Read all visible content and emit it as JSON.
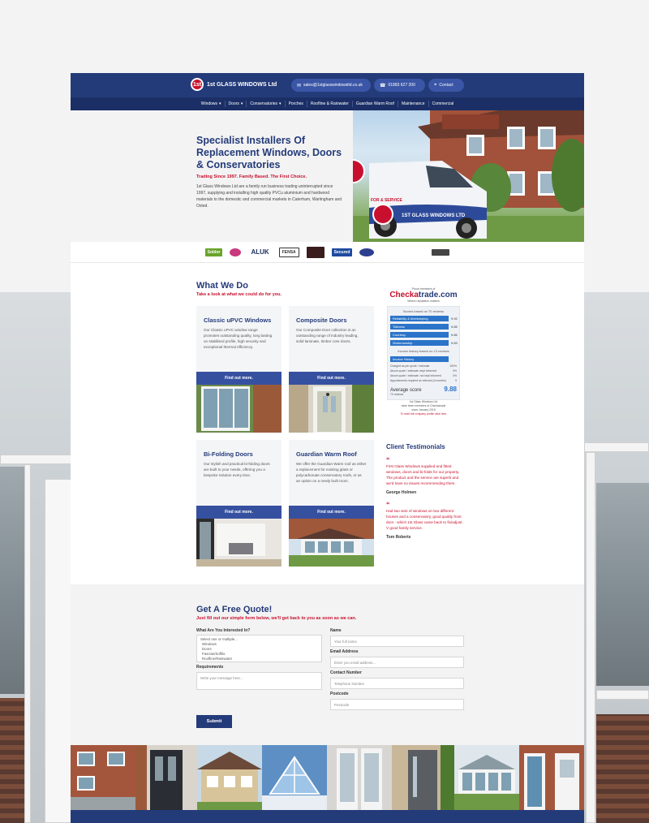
{
  "header": {
    "logo_text": "1st GLASS WINDOWS Ltd",
    "logo_badge": "1st",
    "email": "sales@1stglasswindowsltd.co.uk",
    "phone": "01883 627 200",
    "contact_label": "Contact"
  },
  "nav": {
    "items": [
      {
        "label": "Windows",
        "dropdown": true
      },
      {
        "label": "Doors",
        "dropdown": true
      },
      {
        "label": "Conservatories",
        "dropdown": true
      },
      {
        "label": "Porches",
        "dropdown": false
      },
      {
        "label": "Roofline & Rainwater",
        "dropdown": false
      },
      {
        "label": "Guardian Warm Roof",
        "dropdown": false
      },
      {
        "label": "Maintenance",
        "dropdown": false
      },
      {
        "label": "Commercial",
        "dropdown": false
      }
    ]
  },
  "hero": {
    "title": "Specialist Installers Of Replacement Windows, Doors & Conservatories",
    "subtitle": "Trading Since 1997. Family Based. The First Choice.",
    "body": "1st Glass Windows Ltd are a family run business trading uninterrupted since 1997, supplying and installing high quality PVCu aluminium and hardwood materials to the domestic and commercial markets in Caterham, Warlingham and Oxted.",
    "van_text": "1ST GLASS WINDOWS LTD",
    "van_service": "FOR & SERVICE"
  },
  "brands": [
    "Soldor",
    "",
    "ALUK",
    "FENSA",
    "",
    "Secured",
    "",
    "",
    "",
    ""
  ],
  "what_we_do": {
    "title": "What We Do",
    "subtitle": "Take a look at what we could do for you.",
    "services": [
      {
        "title": "Classic uPVC Windows",
        "desc": "Our Classic uPVC window range promotes outstanding quality, long lasting un stabilised profile, high security and exceptional thermal efficiency.",
        "button": "Find out more."
      },
      {
        "title": "Composite Doors",
        "desc": "Our Composite Door collection is an outstanding range of industry leading, solid laminate, timber core doors.",
        "button": "Find out more."
      },
      {
        "title": "Bi-Folding Doors",
        "desc": "Our stylish and practical bi-folding doors are built to your needs, offering you a bespoke solution every time.",
        "button": "Find out more."
      },
      {
        "title": "Guardian Warm Roof",
        "desc": "We offer the Guardian Warm roof as either a replacement for existing glass or polycarbonate conservatory roofs, or as an option on a newly built room.",
        "button": "Find out more."
      }
    ]
  },
  "checkatrade": {
    "proud": "Proud members of",
    "logo_a": "Checka",
    "logo_b": "trade.com",
    "tagline": "Where reputation matters",
    "scores_head": "Scores based on 70 reviews",
    "scores": [
      {
        "label": "Reliability & timekeeping",
        "value": "9.92"
      },
      {
        "label": "Tidiness",
        "value": "9.85"
      },
      {
        "label": "Courtesy",
        "value": "9.85"
      },
      {
        "label": "Workmanship",
        "value": "9.83"
      }
    ],
    "invoice_head": "Invoice history based on 13 reviews",
    "invoice_label": "Invoice History",
    "invoice_lines": [
      {
        "label": "Charged as per quote / estimate",
        "value": "100%"
      },
      {
        "label": "Above quote / estimate: kept informed",
        "value": "0%"
      },
      {
        "label": "Above quote / estimate: not kept informed",
        "value": "0%"
      },
      {
        "label": "Appointments required as relevant (4 months)",
        "value": "9"
      }
    ],
    "avg_label": "Average score",
    "avg_value": "9.88",
    "reviews": "70 reviews",
    "member_line1": "1st Glass Windows Ltd",
    "member_line2": "have been members of Checkatrade",
    "member_line3": "since January 2018",
    "link": "To read full company profile click here"
  },
  "testimonials": {
    "title": "Client Testimonials",
    "items": [
      {
        "quote": "First Glass Windows supplied and fitted windows, doors and bi-folds for our property. The product and the service are superb and we'd have no issues recommending them.",
        "author": "George Holmen"
      },
      {
        "quote": "Had two sets of windows on two different houses and a conservatory, good quality front door - which 1st Glass came back to fix/adjust. V good family service.",
        "author": "Tom Roberts"
      }
    ]
  },
  "quote_form": {
    "title": "Get A Free Quote!",
    "subtitle": "Just fill out our simple form below, we'll get back to you as soon as we can.",
    "interest_label": "What Are You Interested In?",
    "interest_options": [
      "Select one or multiple...",
      "Windows",
      "Doors",
      "Fascias/Soffits",
      "Roofline/Rainwater"
    ],
    "requirements_label": "Requirements",
    "requirements_placeholder": "Write your message here...",
    "name_label": "Name",
    "name_placeholder": "Your full name",
    "email_label": "Email Address",
    "email_placeholder": "Enter you email address...",
    "phone_label": "Contact Number",
    "phone_placeholder": "Telephone Number",
    "postcode_label": "Postcode",
    "postcode_placeholder": "Postcode",
    "submit": "Submit"
  },
  "colors": {
    "navy": "#243b7a",
    "red": "#c8102e",
    "button_blue": "#3650a0"
  }
}
